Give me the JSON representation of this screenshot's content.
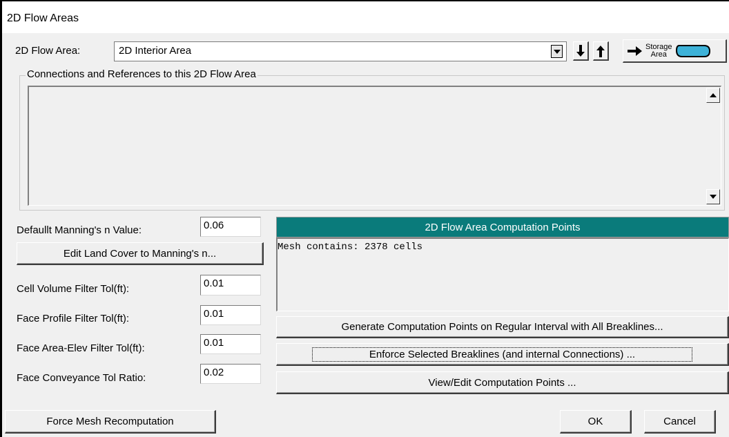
{
  "window": {
    "title": "2D Flow Areas"
  },
  "flow_area": {
    "label": "2D Flow Area:",
    "value": "2D Interior Area",
    "down_icon": "arrow-down-icon",
    "up_icon": "arrow-up-icon",
    "storage_button": {
      "line1": "Storage",
      "line2": "Area",
      "shape_color": "#3db2d8"
    }
  },
  "connections": {
    "title": "Connections and References to this 2D Flow Area"
  },
  "manning": {
    "label": "Defaullt Manning's n Value:",
    "value": "0.06",
    "edit_button": "Edit Land Cover to Manning's n..."
  },
  "filters": [
    {
      "label": "Cell Volume Filter Tol(ft):",
      "value": "0.01"
    },
    {
      "label": "Face Profile Filter Tol(ft):",
      "value": "0.01"
    },
    {
      "label": "Face Area-Elev Filter Tol(ft):",
      "value": "0.01"
    },
    {
      "label": "Face Conveyance Tol Ratio:",
      "value": "0.02"
    }
  ],
  "computation": {
    "header": "2D Flow Area Computation Points",
    "header_color": "#0a7b7b",
    "mesh_info": "Mesh contains: 2378 cells",
    "generate_button": "Generate Computation Points on Regular Interval with All Breaklines...",
    "enforce_button": "Enforce Selected Breaklines (and internal Connections) ...",
    "view_button": "View/Edit Computation Points ..."
  },
  "footer": {
    "force_button": "Force Mesh Recomputation",
    "ok_button": "OK",
    "cancel_button": "Cancel"
  }
}
